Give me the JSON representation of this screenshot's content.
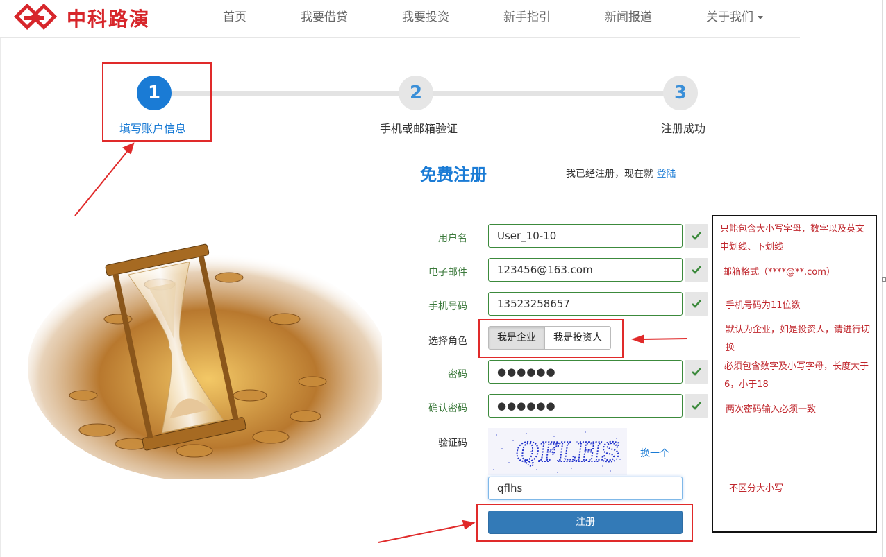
{
  "brand": {
    "name": "中科路演",
    "color": "#d7262b"
  },
  "nav": {
    "items": [
      {
        "label": "首页"
      },
      {
        "label": "我要借贷"
      },
      {
        "label": "我要投资"
      },
      {
        "label": "新手指引"
      },
      {
        "label": "新闻报道"
      },
      {
        "label": "关于我们"
      }
    ]
  },
  "steps": [
    {
      "number": "1",
      "label": "填写账户信息",
      "active": true
    },
    {
      "number": "2",
      "label": "手机或邮箱验证",
      "active": false
    },
    {
      "number": "3",
      "label": "注册成功",
      "active": false
    }
  ],
  "form": {
    "title": "免费注册",
    "login_prompt": "我已经注册，现在就",
    "login_link": "登陆",
    "fields": {
      "username": {
        "label": "用户名",
        "value": "User_10-10"
      },
      "email": {
        "label": "电子邮件",
        "value": "123456@163.com"
      },
      "phone": {
        "label": "手机号码",
        "value": "13523258657"
      },
      "role": {
        "label": "选择角色",
        "options": [
          "我是企业",
          "我是投资人"
        ],
        "selected": "我是企业"
      },
      "password": {
        "label": "密码",
        "value": "●●●●●●"
      },
      "confirm_password": {
        "label": "确认密码",
        "value": "●●●●●●"
      },
      "captcha": {
        "label": "验证码",
        "image_text": "QFLHS",
        "refresh_label": "换一个",
        "value": "qflhs"
      }
    },
    "submit_label": "注册"
  },
  "notes": {
    "username": "只能包含大小写字母，数字以及英文中划线、下划线",
    "email": "邮箱格式（****@**.com）",
    "phone": "手机号码为11位数",
    "role": "默认为企业，如是投资人，请进行切换",
    "password": "必须包含数字及小写字母，长度大于6，小于18",
    "confirm": "两次密码输入必须一致",
    "captcha": "不区分大小写"
  },
  "colors": {
    "accent": "#1a7bd5",
    "valid": "#3c8a3c",
    "annotation": "#e02a2a",
    "submit": "#337ab7"
  }
}
